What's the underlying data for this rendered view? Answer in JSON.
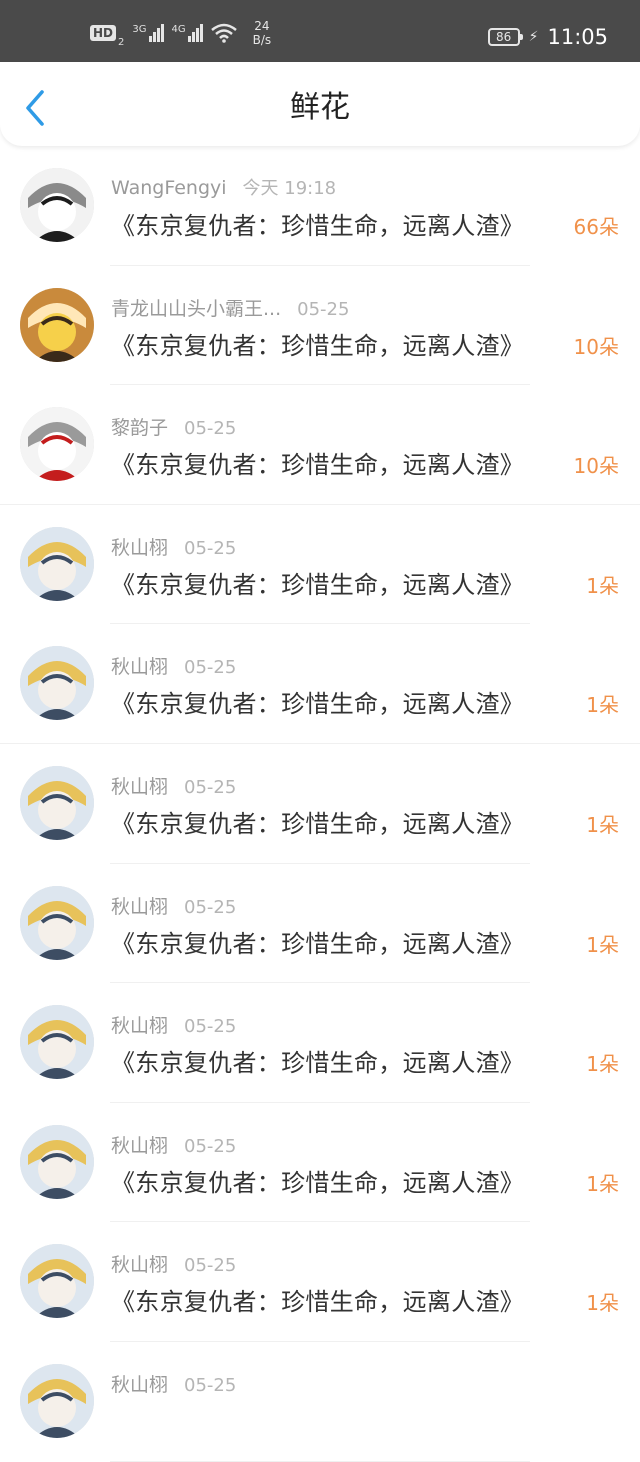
{
  "status_bar": {
    "hd_label": "HD",
    "sim_label": "2",
    "network_3g_label": "3G",
    "network_4g_label": "4G",
    "speed_value": "24",
    "speed_unit": "B/s",
    "battery_level": "86",
    "time": "11:05",
    "icons": [
      "signal-3g-icon",
      "signal-4g-icon",
      "wifi-icon",
      "battery-icon",
      "charging-icon"
    ]
  },
  "header": {
    "title": "鲜花",
    "back_icon": "chevron-left-icon",
    "accent_color": "#2f9be6"
  },
  "colors": {
    "count": "#f0914a",
    "name": "#9a9a9a",
    "time": "#b5b5b5",
    "book": "#333333"
  },
  "list": [
    {
      "name": "WangFengyi",
      "time": "今天 19:18",
      "book": "《东京复仇者：珍惜生命，远离人渣》",
      "count": "66朵"
    },
    {
      "name": "青龙山山头小霸王...",
      "time": "05-25",
      "book": "《东京复仇者：珍惜生命，远离人渣》",
      "count": "10朵"
    },
    {
      "name": "黎韵子",
      "time": "05-25",
      "book": "《东京复仇者：珍惜生命，远离人渣》",
      "count": "10朵"
    },
    {
      "name": "秋山栩",
      "time": "05-25",
      "book": "《东京复仇者：珍惜生命，远离人渣》",
      "count": "1朵"
    },
    {
      "name": "秋山栩",
      "time": "05-25",
      "book": "《东京复仇者：珍惜生命，远离人渣》",
      "count": "1朵"
    },
    {
      "name": "秋山栩",
      "time": "05-25",
      "book": "《东京复仇者：珍惜生命，远离人渣》",
      "count": "1朵"
    },
    {
      "name": "秋山栩",
      "time": "05-25",
      "book": "《东京复仇者：珍惜生命，远离人渣》",
      "count": "1朵"
    },
    {
      "name": "秋山栩",
      "time": "05-25",
      "book": "《东京复仇者：珍惜生命，远离人渣》",
      "count": "1朵"
    },
    {
      "name": "秋山栩",
      "time": "05-25",
      "book": "《东京复仇者：珍惜生命，远离人渣》",
      "count": "1朵"
    },
    {
      "name": "秋山栩",
      "time": "05-25",
      "book": "《东京复仇者：珍惜生命，远离人渣》",
      "count": "1朵"
    },
    {
      "name": "秋山栩",
      "time": "05-25",
      "book": "",
      "count": ""
    }
  ]
}
